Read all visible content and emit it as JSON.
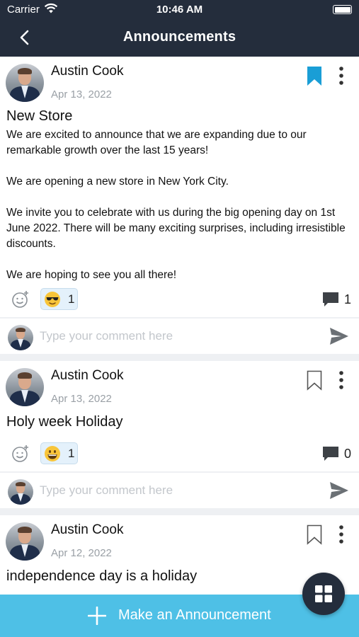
{
  "status_bar": {
    "carrier": "Carrier",
    "time": "10:46 AM"
  },
  "nav": {
    "title": "Announcements",
    "back_icon": "chevron-left-icon"
  },
  "colors": {
    "header": "#242d3c",
    "accent": "#4ec0e6",
    "bookmark_active": "#1a9ed6"
  },
  "posts": [
    {
      "author": "Austin Cook",
      "date": "Apr 13, 2022",
      "bookmarked": true,
      "title": "New Store",
      "body": [
        "We are excited to announce that we are expanding due to our remarkable growth over the last 15 years!",
        "",
        "We are opening a new store in New York City.",
        "",
        "We invite you to celebrate with us during the big opening day on 1st June 2022. There will be many exciting surprises, including irresistible discounts.",
        "",
        "We are hoping to see you all there!"
      ],
      "reaction": {
        "emoji": "smiling-face-with-sunglasses",
        "count": "1"
      },
      "comment_count": "1",
      "comment_placeholder": "Type your comment here"
    },
    {
      "author": "Austin Cook",
      "date": "Apr 13, 2022",
      "bookmarked": false,
      "title": "Holy week Holiday",
      "body": [],
      "reaction": {
        "emoji": "grinning-face",
        "count": "1"
      },
      "comment_count": "0",
      "comment_placeholder": "Type your comment here"
    },
    {
      "author": "Austin Cook",
      "date": "Apr 12, 2022",
      "bookmarked": false,
      "title": "independence day is a holiday",
      "body": []
    }
  ],
  "bottom_bar": {
    "label": "Make an Announcement"
  },
  "fab": {
    "icon": "grid-icon"
  }
}
